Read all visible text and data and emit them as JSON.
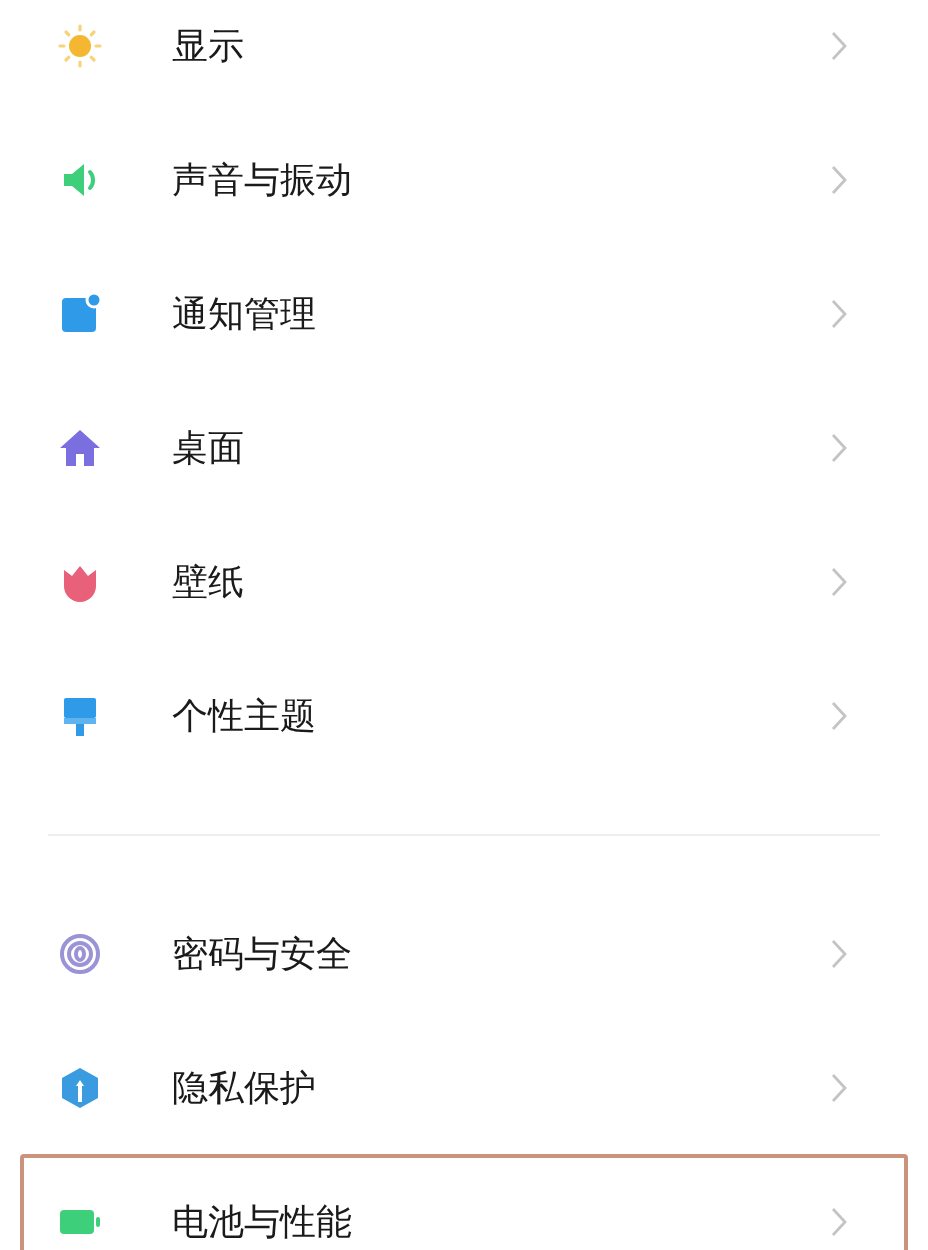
{
  "groups": [
    {
      "items": [
        {
          "label": "显示",
          "highlighted": false
        },
        {
          "label": "声音与振动",
          "highlighted": false
        },
        {
          "label": "通知管理",
          "highlighted": false
        },
        {
          "label": "桌面",
          "highlighted": false
        },
        {
          "label": "壁纸",
          "highlighted": false
        },
        {
          "label": "个性主题",
          "highlighted": false
        }
      ]
    },
    {
      "items": [
        {
          "label": "密码与安全",
          "highlighted": false
        },
        {
          "label": "隐私保护",
          "highlighted": false
        },
        {
          "label": "电池与性能",
          "highlighted": true
        }
      ]
    }
  ]
}
